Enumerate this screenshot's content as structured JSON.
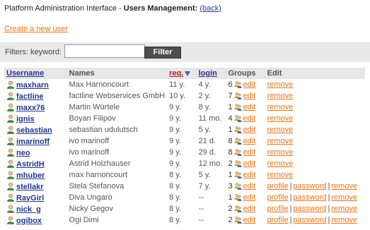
{
  "header": {
    "prefix": "Platform Administration Interface - ",
    "title": "Users Management:",
    "back_label": "(back)"
  },
  "create_link": "Create a new user",
  "filters": {
    "label": "Filters: keyword:",
    "keyword_value": "",
    "button_label": "Filter"
  },
  "columns": {
    "username": "Username",
    "names": "Names",
    "reg": "req.",
    "login": "login",
    "groups": "Groups",
    "edit": "Edit"
  },
  "sort": {
    "column": "reg",
    "direction": "descending"
  },
  "actions": {
    "edit": "edit",
    "remove": "remove",
    "profile": "profile",
    "password": "password",
    "sep": "|"
  },
  "users": [
    {
      "username": "maxharn",
      "name": "Max Harnoncourt",
      "reg": "11 y.",
      "login": "4 y.",
      "groups": "6",
      "extended": false
    },
    {
      "username": "factline",
      "name": "factline Webservices GmbH",
      "reg": "10 y.",
      "login": "2 y.",
      "groups": "7",
      "extended": false
    },
    {
      "username": "maxx76",
      "name": "Martin Würtele",
      "reg": "9 y.",
      "login": "8 y.",
      "groups": "1",
      "extended": false
    },
    {
      "username": "ignis",
      "name": "Boyan Filipov",
      "reg": "9 y.",
      "login": "11 mo.",
      "groups": "4",
      "extended": false
    },
    {
      "username": "sebastian",
      "name": "sebastian udulutsch",
      "reg": "9 y.",
      "login": "5 y.",
      "groups": "1",
      "extended": false
    },
    {
      "username": "imarinoff",
      "name": "ivo marinoff",
      "reg": "9 y.",
      "login": "21 d.",
      "groups": "8",
      "extended": false
    },
    {
      "username": "neo",
      "name": "ivo marinoff",
      "reg": "9 y.",
      "login": "29 d.",
      "groups": "8",
      "extended": false
    },
    {
      "username": "AstridH",
      "name": "Astrid Holzhauser",
      "reg": "9 y.",
      "login": "12 mo.",
      "groups": "2",
      "extended": false
    },
    {
      "username": "mhuber",
      "name": "max harnoncourt",
      "reg": "8 y.",
      "login": "5 y.",
      "groups": "1",
      "extended": false
    },
    {
      "username": "stellakr",
      "name": "Stela Stefanova",
      "reg": "8 y.",
      "login": "7 y.",
      "groups": "3",
      "extended": true
    },
    {
      "username": "RayGirl",
      "name": "Diva Ungaro",
      "reg": "8 y.",
      "login": "--",
      "groups": "1",
      "extended": true
    },
    {
      "username": "nick_g",
      "name": "Nicky Gegov",
      "reg": "8 y.",
      "login": "--",
      "groups": "2",
      "extended": true
    },
    {
      "username": "ogibox",
      "name": "Ogi Dimi",
      "reg": "8 y.",
      "login": "--",
      "groups": "2",
      "extended": true
    }
  ],
  "colors": {
    "link_blue": "#23378a",
    "link_orange": "#e8761a",
    "sort_red": "#b22222",
    "header_bg": "#e6e6e6",
    "filter_bg": "#e9e9e9",
    "button_bg": "#4d4d4d"
  },
  "icons": {
    "user": "user-icon",
    "group": "group-icon",
    "sort": "sort-down-arrow-icon"
  }
}
